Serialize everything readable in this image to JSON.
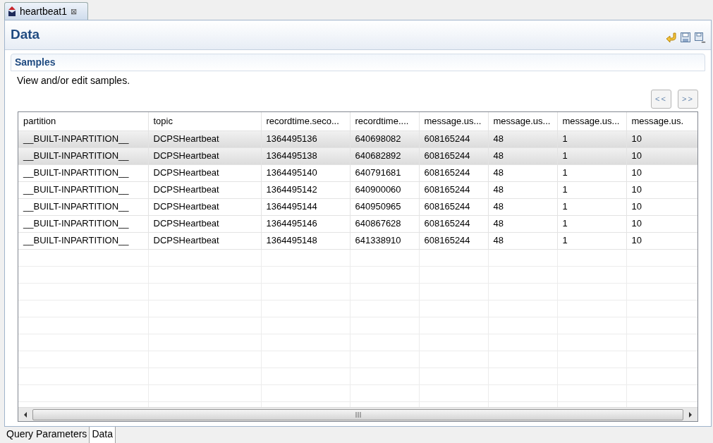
{
  "editor_tab": {
    "title": "heartbeat1",
    "close": "⊠"
  },
  "page": {
    "title": "Data"
  },
  "section": {
    "title": "Samples",
    "description": "View and/or edit samples."
  },
  "pager": [
    "<<",
    ">>"
  ],
  "table": {
    "columns": [
      "partition",
      "topic",
      "recordtime.seco...",
      "recordtime....",
      "message.us...",
      "message.us...",
      "message.us...",
      "message.us."
    ],
    "rows": [
      {
        "selected": true,
        "cells": [
          "__BUILT-INPARTITION__",
          "DCPSHeartbeat",
          "1364495136",
          "640698082",
          "608165244",
          "48",
          "1",
          "10"
        ]
      },
      {
        "selected": true,
        "cells": [
          "__BUILT-INPARTITION__",
          "DCPSHeartbeat",
          "1364495138",
          "640682892",
          "608165244",
          "48",
          "1",
          "10"
        ]
      },
      {
        "selected": false,
        "cells": [
          "__BUILT-INPARTITION__",
          "DCPSHeartbeat",
          "1364495140",
          "640791681",
          "608165244",
          "48",
          "1",
          "10"
        ]
      },
      {
        "selected": false,
        "cells": [
          "__BUILT-INPARTITION__",
          "DCPSHeartbeat",
          "1364495142",
          "640900060",
          "608165244",
          "48",
          "1",
          "10"
        ]
      },
      {
        "selected": false,
        "cells": [
          "__BUILT-INPARTITION__",
          "DCPSHeartbeat",
          "1364495144",
          "640950965",
          "608165244",
          "48",
          "1",
          "10"
        ]
      },
      {
        "selected": false,
        "cells": [
          "__BUILT-INPARTITION__",
          "DCPSHeartbeat",
          "1364495146",
          "640867628",
          "608165244",
          "48",
          "1",
          "10"
        ]
      },
      {
        "selected": false,
        "cells": [
          "__BUILT-INPARTITION__",
          "DCPSHeartbeat",
          "1364495148",
          "641338910",
          "608165244",
          "48",
          "1",
          "10"
        ]
      }
    ]
  },
  "bottom_tabs": [
    {
      "label": "Query Parameters",
      "selected": false
    },
    {
      "label": "Data",
      "selected": true
    }
  ]
}
